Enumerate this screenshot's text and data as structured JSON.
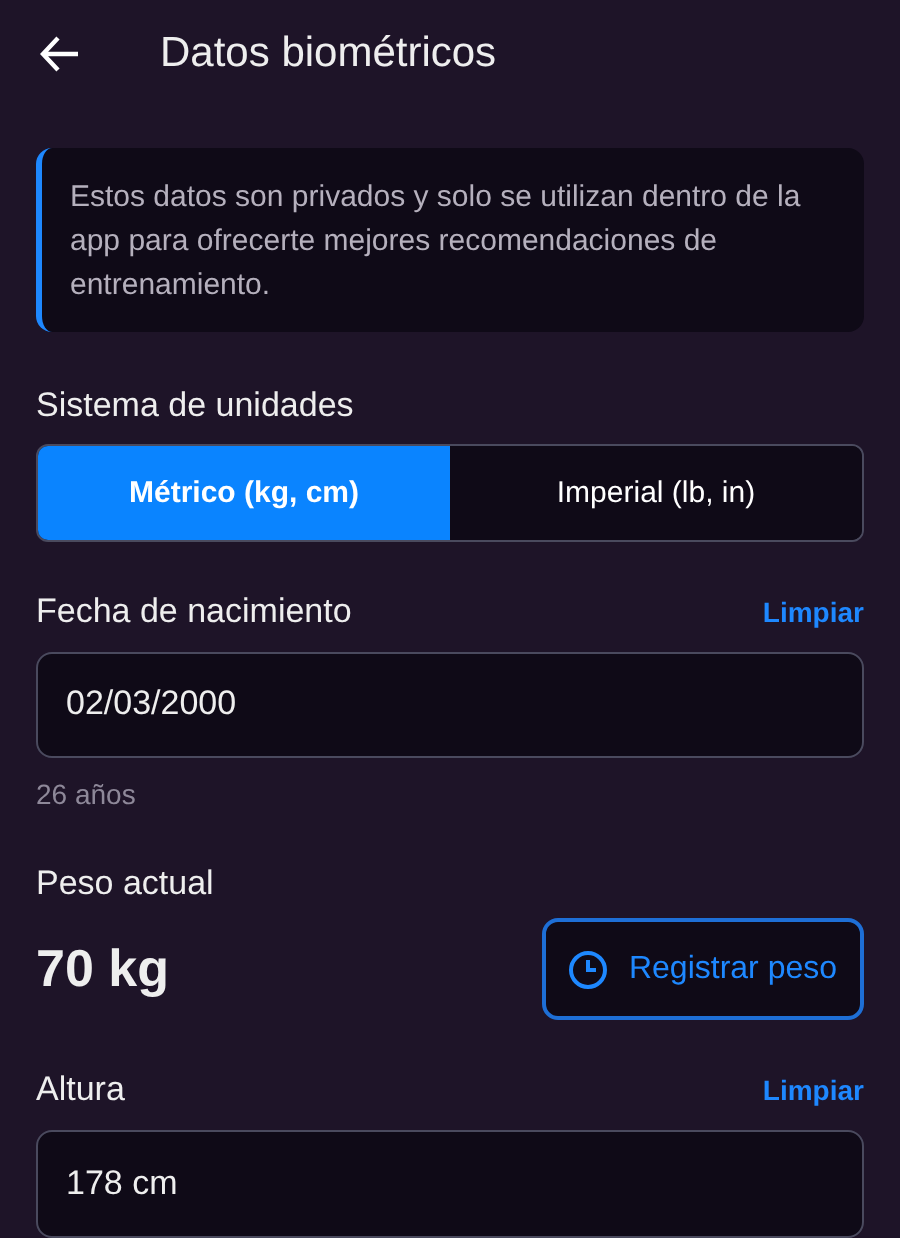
{
  "header": {
    "title": "Datos biométricos"
  },
  "info": "Estos datos son privados y solo se utilizan dentro de la app para ofrecerte mejores recomendaciones de entrenamiento.",
  "units": {
    "label": "Sistema de unidades",
    "options": [
      {
        "label": "Métrico (kg, cm)",
        "selected": true
      },
      {
        "label": "Imperial (lb, in)",
        "selected": false
      }
    ]
  },
  "birth": {
    "label": "Fecha de nacimiento",
    "clear": "Limpiar",
    "value": "02/03/2000",
    "hint": "26 años"
  },
  "weight": {
    "label": "Peso actual",
    "value": "70 kg",
    "button": "Registrar peso"
  },
  "height": {
    "label": "Altura",
    "clear": "Limpiar",
    "value": "178 cm"
  }
}
